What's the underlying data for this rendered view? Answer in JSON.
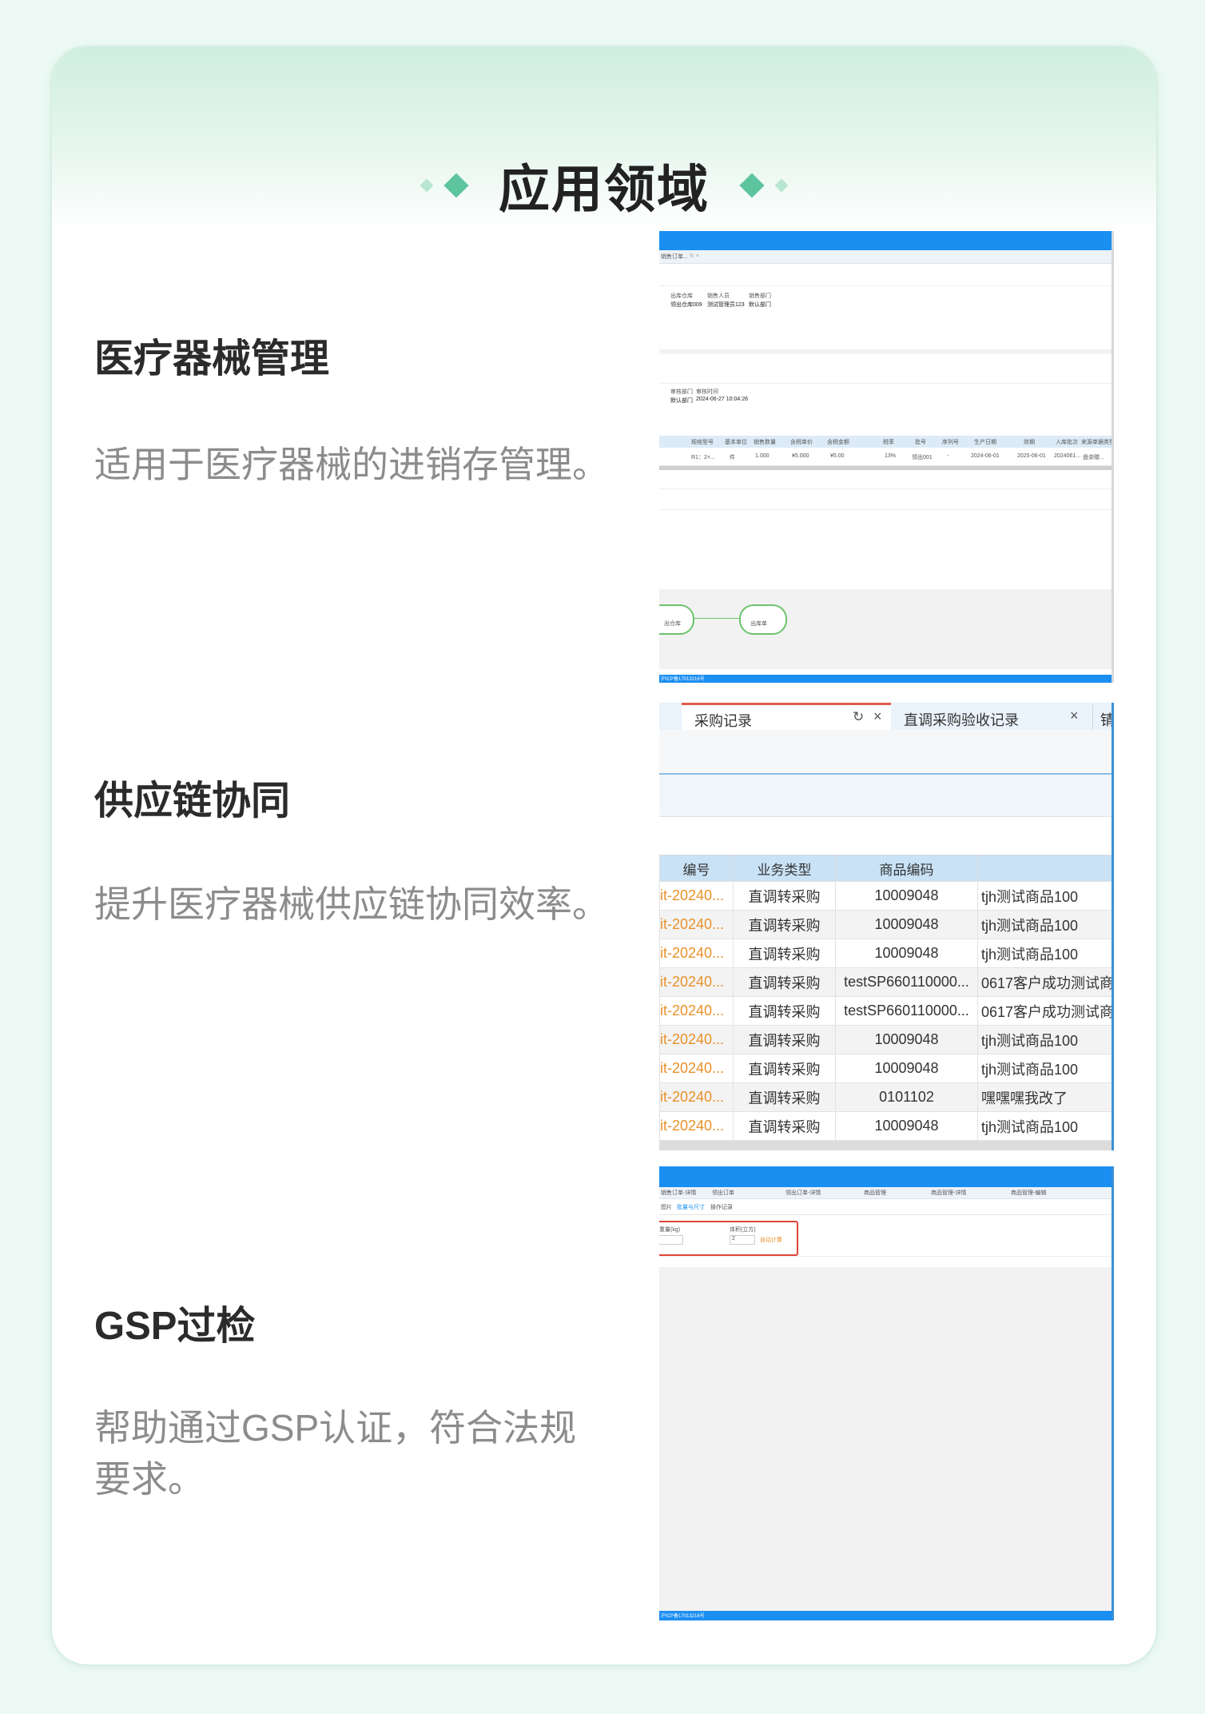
{
  "page_title": "应用领域",
  "items": [
    {
      "title": "医疗器械管理",
      "desc": "适用于医疗器械的进销存管理。"
    },
    {
      "title": "供应链协同",
      "desc": "提升医疗器械供应链协同效率。"
    },
    {
      "title": "GSP过检",
      "desc": "帮助通过GSP认证，符合法规要求。"
    }
  ],
  "shot2": {
    "tab_active": "采购记录",
    "tab_other": "直调采购验收记录",
    "tab_cut": "锖",
    "columns": [
      "编号",
      "业务类型",
      "商品编码",
      ""
    ],
    "rows": [
      [
        "it-20240...",
        "直调转采购",
        "10009048",
        "tjh测试商品100"
      ],
      [
        "it-20240...",
        "直调转采购",
        "10009048",
        "tjh测试商品100"
      ],
      [
        "it-20240...",
        "直调转采购",
        "10009048",
        "tjh测试商品100"
      ],
      [
        "it-20240...",
        "直调转采购",
        "testSP660110000...",
        "0617客户成功测试商"
      ],
      [
        "it-20240...",
        "直调转采购",
        "testSP660110000...",
        "0617客户成功测试商"
      ],
      [
        "it-20240...",
        "直调转采购",
        "10009048",
        "tjh测试商品100"
      ],
      [
        "it-20240...",
        "直调转采购",
        "10009048",
        "tjh测试商品100"
      ],
      [
        "it-20240...",
        "直调转采购",
        "0101102",
        "嘿嘿嘿我改了"
      ],
      [
        "it-20240...",
        "直调转采购",
        "10009048",
        "tjh测试商品100"
      ]
    ]
  },
  "shot1": {
    "tab": "销售订单...",
    "row1_labels": [
      "出库仓库",
      "销售人员",
      "销售部门"
    ],
    "row1_values": [
      "领出仓库009",
      "测试管理员123",
      "默认部门"
    ],
    "row2_labels": [
      "审核部门",
      "审核时间"
    ],
    "row2_values": [
      "默认部门",
      "2024-06-27 10:04:26"
    ],
    "grid_headers": [
      "规格型号",
      "基本单位",
      "销售数量",
      "含税单价",
      "含税金额",
      "税率",
      "批号",
      "序列号",
      "生产日期",
      "效期",
      "入库批次",
      "来源单据类型"
    ],
    "grid_values": [
      "R1：2×...",
      "件",
      "1.000",
      "¥5.000",
      "¥5.00",
      "13%",
      "领出001",
      "-",
      "2024-06-01",
      "2025-06-01",
      "2024061...",
      "盘余赠..."
    ],
    "flow": [
      "出仓库",
      "出库单"
    ],
    "footer": "沪ICP备17013216号"
  },
  "shot3": {
    "tabs": [
      "销售订单-详情",
      "领出订单",
      "领出订单-详情",
      "商品管理",
      "商品管理-详情",
      "商品管理-编辑"
    ],
    "subtabs": [
      "图片",
      "批量与尺寸",
      "操作记录"
    ],
    "field1_label": "重量(kg)",
    "field2_label": "体积(立方)",
    "field2_value": "2",
    "action": "自动计算",
    "footer": "沪ICP备17013216号"
  },
  "colors": {
    "accent": "#5dc4a0",
    "blue": "#1b8ef2",
    "orange": "#e8912a"
  }
}
